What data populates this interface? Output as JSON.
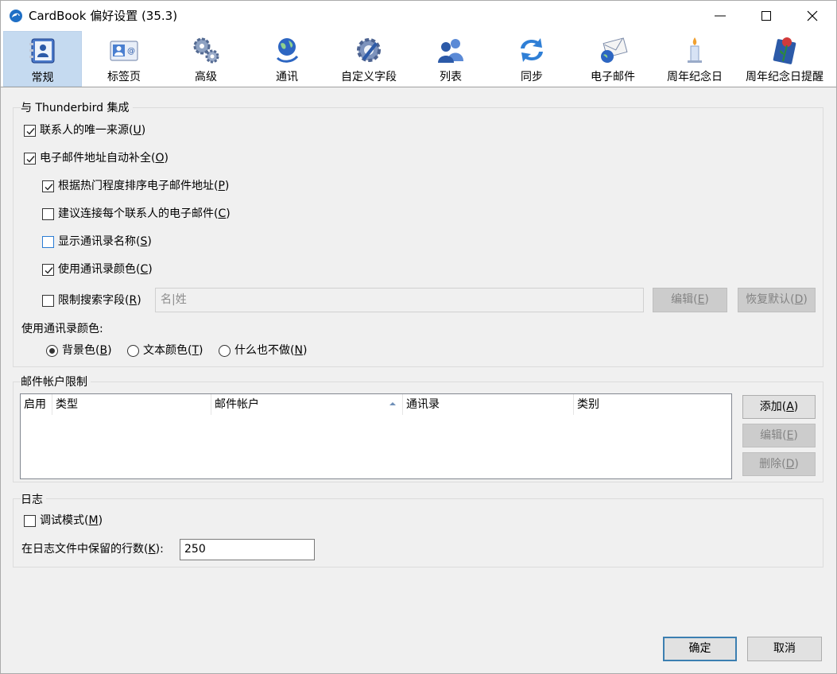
{
  "window": {
    "title": "CardBook 偏好设置 (35.3)"
  },
  "toolbar": {
    "tabs": [
      {
        "label": "常规",
        "icon": "general-addressbook-icon",
        "selected": true
      },
      {
        "label": "标签页",
        "icon": "tabs-contactcard-icon"
      },
      {
        "label": "高级",
        "icon": "advanced-gears-icon"
      },
      {
        "label": "通讯",
        "icon": "communication-globe-icon"
      },
      {
        "label": "自定义字段",
        "icon": "custom-fields-gear-pen-icon"
      },
      {
        "label": "列表",
        "icon": "lists-people-icon"
      },
      {
        "label": "同步",
        "icon": "sync-arrows-icon"
      },
      {
        "label": "电子邮件",
        "icon": "email-envelope-icon"
      },
      {
        "label": "周年纪念日",
        "icon": "anniversary-candle-icon"
      },
      {
        "label": "周年纪念日提醒",
        "icon": "anniversary-reminder-rose-icon"
      }
    ]
  },
  "thunderbird": {
    "title": "与 Thunderbird 集成",
    "unique_source": {
      "text": "联系人的唯一来源(",
      "key": "U",
      "end": ")",
      "checked": true
    },
    "autocomplete": {
      "text": "电子邮件地址自动补全(",
      "key": "O",
      "end": ")",
      "checked": true
    },
    "sort_by_popularity": {
      "text": "根据热门程度排序电子邮件地址(",
      "key": "P",
      "end": ")",
      "checked": true
    },
    "propose_concatenated": {
      "text": "建议连接每个联系人的电子邮件(",
      "key": "C",
      "end": ")",
      "checked": false
    },
    "show_addressbook_name": {
      "text": "显示通讯录名称(",
      "key": "S",
      "end": ")",
      "checked": false
    },
    "use_color": {
      "text": "使用通讯录颜色(",
      "key": "C",
      "end": ")",
      "checked": true
    },
    "restrict_search": {
      "text": "限制搜索字段(",
      "key": "R",
      "end": ")",
      "checked": false
    },
    "search_fields_value": "名|姓",
    "edit_button": {
      "text": "编辑(",
      "key": "E",
      "end": ")"
    },
    "reset_button": {
      "text": "恢复默认(",
      "key": "D",
      "end": ")"
    },
    "color_label": "使用通讯录颜色:",
    "color_options": [
      {
        "text": "背景色(",
        "key": "B",
        "end": ")",
        "selected": true
      },
      {
        "text": "文本颜色(",
        "key": "T",
        "end": ")",
        "selected": false
      },
      {
        "text": "什么也不做(",
        "key": "N",
        "end": ")",
        "selected": false
      }
    ]
  },
  "mail_accounts": {
    "title": "邮件帐户限制",
    "columns": [
      "启用",
      "类型",
      "邮件帐户",
      "通讯录",
      "类别"
    ],
    "rows": [],
    "add_button": {
      "text": "添加(",
      "key": "A",
      "end": ")"
    },
    "edit_button": {
      "text": "编辑(",
      "key": "E",
      "end": ")"
    },
    "delete_button": {
      "text": "删除(",
      "key": "D",
      "end": ")"
    }
  },
  "log": {
    "title": "日志",
    "debug_mode": {
      "text": "调试模式(",
      "key": "M",
      "end": ")",
      "checked": false
    },
    "lines_label": {
      "text": "在日志文件中保留的行数(",
      "key": "K",
      "end": "):"
    },
    "lines_value": "250"
  },
  "footer": {
    "ok": "确定",
    "cancel": "取消"
  }
}
